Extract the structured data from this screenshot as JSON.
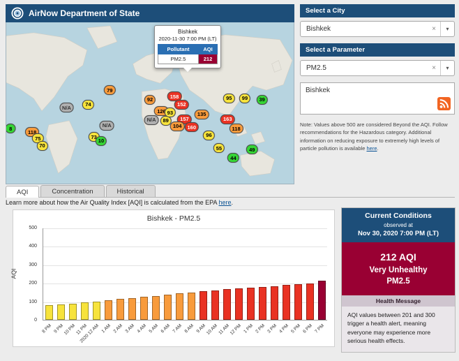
{
  "header": {
    "title": "AirNow Department of State"
  },
  "icons": {
    "clear": "×",
    "dropdown_arrow": "▾"
  },
  "map": {
    "popup": {
      "city": "Bishkek",
      "datetime": "2020-11-30 7:00 PM (LT)",
      "pollutant_header": "Pollutant",
      "aqi_header": "AQI",
      "pollutant": "PM2.5",
      "aqi": "212"
    },
    "markers": [
      {
        "value": "8",
        "color": "green",
        "x": 1.5,
        "y": 66
      },
      {
        "value": "118",
        "color": "orange",
        "x": 9,
        "y": 68
      },
      {
        "value": "75",
        "color": "yellow",
        "x": 11,
        "y": 72
      },
      {
        "value": "70",
        "color": "yellow",
        "x": 12.5,
        "y": 76.5
      },
      {
        "value": "N/A",
        "color": "gray",
        "x": 21,
        "y": 53
      },
      {
        "value": "74",
        "color": "yellow",
        "x": 28.5,
        "y": 51
      },
      {
        "value": "79",
        "color": "orange",
        "x": 36,
        "y": 42
      },
      {
        "value": "92",
        "color": "orange",
        "x": 50,
        "y": 48
      },
      {
        "value": "126",
        "color": "orange",
        "x": 54,
        "y": 55
      },
      {
        "value": "N/A",
        "color": "gray",
        "x": 50.5,
        "y": 60.5
      },
      {
        "value": "89",
        "color": "yellow",
        "x": 55.5,
        "y": 61
      },
      {
        "value": "158",
        "color": "red",
        "x": 58.5,
        "y": 46
      },
      {
        "value": "152",
        "color": "red",
        "x": 61,
        "y": 51
      },
      {
        "value": "93",
        "color": "yellow",
        "x": 57,
        "y": 56
      },
      {
        "value": "157",
        "color": "red",
        "x": 62,
        "y": 60
      },
      {
        "value": "104",
        "color": "orange",
        "x": 59.5,
        "y": 64.5
      },
      {
        "value": "160",
        "color": "red",
        "x": 64.5,
        "y": 65
      },
      {
        "value": "135",
        "color": "orange",
        "x": 68,
        "y": 57
      },
      {
        "value": "163",
        "color": "red",
        "x": 77,
        "y": 60
      },
      {
        "value": "118",
        "color": "orange",
        "x": 80,
        "y": 66
      },
      {
        "value": "96",
        "color": "yellow",
        "x": 70.5,
        "y": 70
      },
      {
        "value": "55",
        "color": "yellow",
        "x": 74,
        "y": 78
      },
      {
        "value": "95",
        "color": "yellow",
        "x": 77.5,
        "y": 47
      },
      {
        "value": "99",
        "color": "yellow",
        "x": 83,
        "y": 47
      },
      {
        "value": "39",
        "color": "green",
        "x": 89,
        "y": 48
      },
      {
        "value": "44",
        "color": "green",
        "x": 79,
        "y": 84
      },
      {
        "value": "49",
        "color": "green",
        "x": 85.5,
        "y": 79
      },
      {
        "value": "73",
        "color": "yellow",
        "x": 30.5,
        "y": 71
      },
      {
        "value": "10",
        "color": "green",
        "x": 33,
        "y": 73.5
      },
      {
        "value": "N/A",
        "color": "gray",
        "x": 35,
        "y": 64
      }
    ]
  },
  "sidebar": {
    "city_section": {
      "title": "Select a City",
      "value": "Bishkek"
    },
    "parameter_section": {
      "title": "Select a Parameter",
      "value": "PM2.5"
    },
    "feed_box": {
      "text": "Bishkek"
    },
    "note": {
      "prefix": "Note: Values above 500 are considered Beyond the AQI. Follow recommendations for the Hazardous category. Additional information on reducing exposure to extremely high levels of particle pollution is available ",
      "link_text": "here",
      "suffix": "."
    }
  },
  "tabs": [
    {
      "label": "AQI",
      "active": true
    },
    {
      "label": "Concentration",
      "active": false
    },
    {
      "label": "Historical",
      "active": false
    }
  ],
  "learn_more": {
    "prefix": "Learn more about how the Air Quality Index [AQI] is calculated from the EPA ",
    "link_text": "here",
    "suffix": "."
  },
  "chart_data": {
    "type": "bar",
    "title": "Bishkek - PM2.5",
    "xlabel": "",
    "ylabel": "AQI",
    "ylim": [
      0,
      500
    ],
    "yticks": [
      0,
      100,
      200,
      300,
      400,
      500
    ],
    "categories": [
      "8 PM",
      "9 PM",
      "10 PM",
      "11 PM",
      "2020 12 AM",
      "1 AM",
      "2 AM",
      "3 AM",
      "4 AM",
      "5 AM",
      "6 AM",
      "7 AM",
      "8 AM",
      "9 AM",
      "10 AM",
      "11 AM",
      "12 PM",
      "1 PM",
      "2 PM",
      "3 PM",
      "4 PM",
      "5 PM",
      "6 PM",
      "7 PM"
    ],
    "values": [
      78,
      84,
      88,
      95,
      100,
      106,
      112,
      118,
      124,
      130,
      137,
      143,
      149,
      155,
      160,
      165,
      170,
      174,
      179,
      183,
      188,
      193,
      198,
      212
    ],
    "colors": [
      "yellow",
      "yellow",
      "yellow",
      "yellow",
      "yellow",
      "orange",
      "orange",
      "orange",
      "orange",
      "orange",
      "orange",
      "orange",
      "orange",
      "red",
      "red",
      "red",
      "red",
      "red",
      "red",
      "red",
      "red",
      "red",
      "red",
      "maroon"
    ]
  },
  "current_conditions": {
    "title": "Current Conditions",
    "observed_at_label": "observed at",
    "observed_at": "Nov 30, 2020 7:00 PM (LT)",
    "aqi_value": "212 AQI",
    "category": "Very Unhealthy",
    "parameter": "PM2.5",
    "health_message_title": "Health Message",
    "health_message": "AQI values between 201 and 300 trigger a health alert, meaning everyone may experience more serious health effects."
  },
  "colors": {
    "navy": "#1d4e79",
    "maroon": "#990033",
    "green": "#35d435",
    "yellow": "#f7e33c",
    "orange": "#f89b3c",
    "red": "#e93223",
    "gray": "#b0b0b0",
    "rss_orange": "#f26522"
  }
}
